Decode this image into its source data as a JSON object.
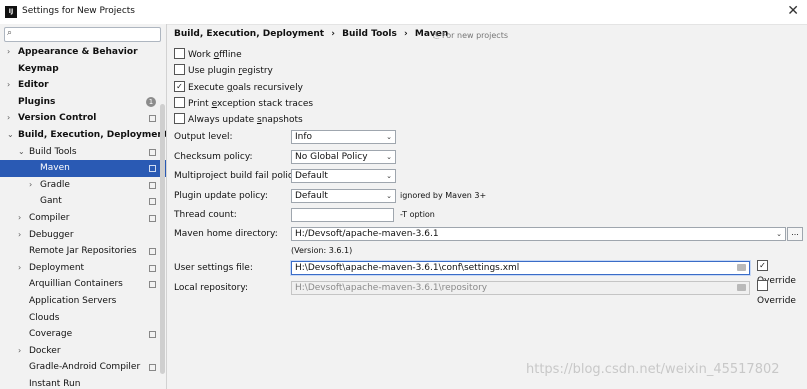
{
  "window": {
    "title": "Settings for New Projects",
    "close": "✕",
    "app_icon": "IJ"
  },
  "search": {
    "placeholder": "",
    "icon": "search-icon"
  },
  "tree": [
    {
      "label": "Appearance & Behavior",
      "level": 0,
      "bold": true,
      "arrow": "›",
      "icon": "none"
    },
    {
      "label": "Keymap",
      "level": 0,
      "bold": true,
      "arrow": "",
      "icon": "none"
    },
    {
      "label": "Editor",
      "level": 0,
      "bold": true,
      "arrow": "›",
      "icon": "none"
    },
    {
      "label": "Plugins",
      "level": 0,
      "bold": true,
      "arrow": "",
      "icon": "badge",
      "badge": "1"
    },
    {
      "label": "Version Control",
      "level": 0,
      "bold": true,
      "arrow": "›",
      "icon": "scope"
    },
    {
      "label": "Build, Execution, Deployment",
      "level": 0,
      "bold": true,
      "arrow": "⌄",
      "icon": "none"
    },
    {
      "label": "Build Tools",
      "level": 1,
      "bold": false,
      "arrow": "⌄",
      "icon": "scope"
    },
    {
      "label": "Maven",
      "level": 2,
      "bold": false,
      "arrow": "",
      "icon": "scope",
      "selected": true
    },
    {
      "label": "Gradle",
      "level": 2,
      "bold": false,
      "arrow": "›",
      "icon": "scope"
    },
    {
      "label": "Gant",
      "level": 2,
      "bold": false,
      "arrow": "",
      "icon": "scope"
    },
    {
      "label": "Compiler",
      "level": 1,
      "bold": false,
      "arrow": "›",
      "icon": "scope"
    },
    {
      "label": "Debugger",
      "level": 1,
      "bold": false,
      "arrow": "›",
      "icon": "none"
    },
    {
      "label": "Remote Jar Repositories",
      "level": 1,
      "bold": false,
      "arrow": "",
      "icon": "scope"
    },
    {
      "label": "Deployment",
      "level": 1,
      "bold": false,
      "arrow": "›",
      "icon": "scope"
    },
    {
      "label": "Arquillian Containers",
      "level": 1,
      "bold": false,
      "arrow": "",
      "icon": "scope"
    },
    {
      "label": "Application Servers",
      "level": 1,
      "bold": false,
      "arrow": "",
      "icon": "none"
    },
    {
      "label": "Clouds",
      "level": 1,
      "bold": false,
      "arrow": "",
      "icon": "none"
    },
    {
      "label": "Coverage",
      "level": 1,
      "bold": false,
      "arrow": "",
      "icon": "scope"
    },
    {
      "label": "Docker",
      "level": 1,
      "bold": false,
      "arrow": "›",
      "icon": "none"
    },
    {
      "label": "Gradle-Android Compiler",
      "level": 1,
      "bold": false,
      "arrow": "",
      "icon": "scope"
    },
    {
      "label": "Instant Run",
      "level": 1,
      "bold": false,
      "arrow": "",
      "icon": "none"
    }
  ],
  "breadcrumb": [
    "Build, Execution, Deployment",
    "›",
    "Build Tools",
    "›",
    "Maven"
  ],
  "scope_note": "For new projects",
  "checkboxes": [
    {
      "pre": "Work ",
      "key": "o",
      "post": "ffline",
      "checked": false
    },
    {
      "pre": "Use plugin ",
      "key": "r",
      "post": "egistry",
      "checked": false
    },
    {
      "pre": "Execute ",
      "key": "g",
      "post": "oals recursively",
      "checked": true
    },
    {
      "pre": "Print ",
      "key": "e",
      "post": "xception stack traces",
      "checked": false
    },
    {
      "pre": "Always update ",
      "key": "s",
      "post": "napshots",
      "checked": false
    }
  ],
  "check_mark": "✓",
  "form": {
    "output_level": {
      "label": "Output level:",
      "value": "Info"
    },
    "checksum_policy": {
      "label": "Checksum policy:",
      "value": "No Global Policy"
    },
    "multiproject_fail_policy": {
      "label": "Multiproject build fail policy:",
      "value": "Default"
    },
    "plugin_update_policy": {
      "label": "Plugin update policy:",
      "value": "Default",
      "note": "ignored by Maven 3+"
    },
    "thread_count": {
      "label": "Thread count:",
      "value": "",
      "note": "-T option"
    },
    "maven_home": {
      "label": "Maven home directory:",
      "value": "H:/Devsoft/apache-maven-3.6.1",
      "version": "(Version: 3.6.1)",
      "browse": "..."
    },
    "user_settings": {
      "label": "User settings file:",
      "value": "H:\\Devsoft\\apache-maven-3.6.1\\conf\\settings.xml",
      "override_label": "Override",
      "override_checked": true
    },
    "local_repo": {
      "label": "Local repository:",
      "value": "H:\\Devsoft\\apache-maven-3.6.1\\repository",
      "override_label": "Override",
      "override_checked": false
    }
  },
  "chevron": "⌄",
  "watermark": "https://blog.csdn.net/weixin_45517802"
}
